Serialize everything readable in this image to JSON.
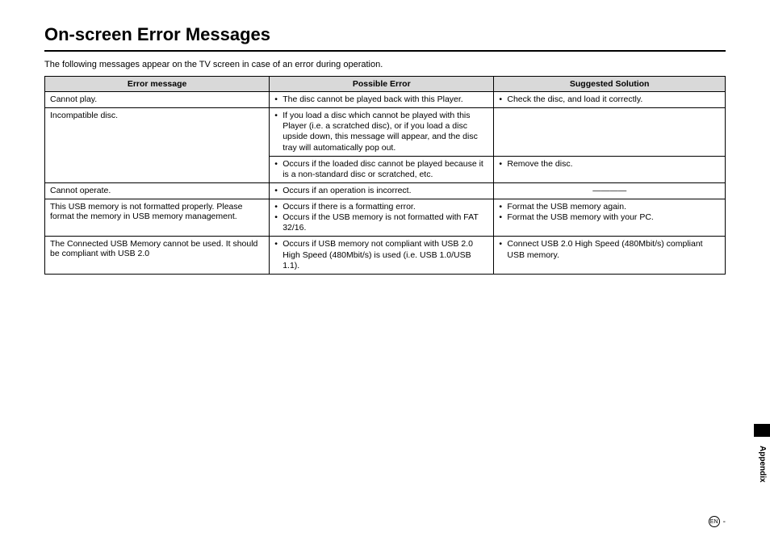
{
  "title": "On-screen Error Messages",
  "intro": "The following messages appear on the TV screen in case of an error during operation.",
  "headers": {
    "c1": "Error message",
    "c2": "Possible Error",
    "c3": "Suggested Solution"
  },
  "rows": {
    "r1": {
      "msg": "Cannot play.",
      "err": [
        "The disc cannot be played back with this Player."
      ],
      "sol": [
        "Check the disc, and load it correctly."
      ]
    },
    "r2": {
      "msg": "Incompatible disc.",
      "err": [
        "If you load a disc which cannot be played with this Player (i.e. a scratched disc), or if you load a disc upside down, this message will appear, and the disc tray will automatically pop out."
      ],
      "sol": []
    },
    "r2b": {
      "err": [
        "Occurs if the loaded disc cannot be played because it is a non-standard disc or scratched, etc."
      ],
      "sol": [
        "Remove the disc."
      ]
    },
    "r3": {
      "msg": "Cannot operate.",
      "err": [
        "Occurs if an operation is incorrect."
      ],
      "sol_dash": "————"
    },
    "r4": {
      "msg": "This USB memory is not formatted properly. Please format the memory in USB memory management.",
      "err": [
        "Occurs if there is a formatting error.",
        "Occurs if the USB memory is not formatted with FAT 32/16."
      ],
      "sol": [
        "Format the USB memory again.",
        "Format the USB memory with your PC."
      ]
    },
    "r5": {
      "msg": "The Connected USB Memory cannot be used. It should be compliant with USB 2.0",
      "err": [
        "Occurs if USB memory not compliant with USB 2.0 High Speed (480Mbit/s) is used (i.e. USB 1.0/USB 1.1)."
      ],
      "sol": [
        "Connect USB 2.0 High Speed (480Mbit/s) compliant USB memory."
      ]
    }
  },
  "sidebar": "Appendix",
  "footer_lang": "EN",
  "footer_dash": " - "
}
